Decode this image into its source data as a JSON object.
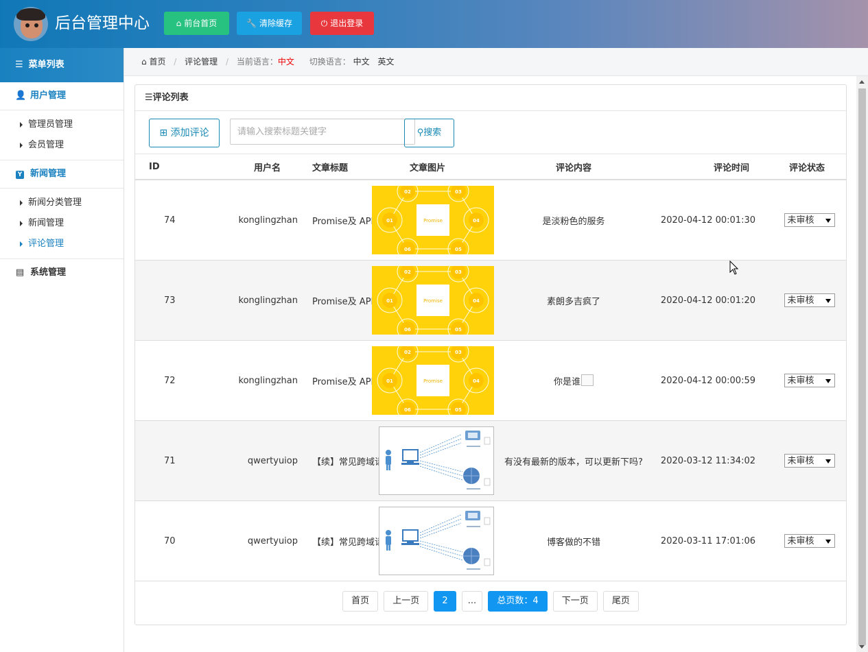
{
  "header": {
    "title": "后台管理中心",
    "buttons": {
      "home": "前台首页",
      "clear_cache": "清除缓存",
      "logout": "退出登录"
    }
  },
  "sidebar": {
    "heading": "菜单列表",
    "categories": [
      {
        "label": "用户管理",
        "items": [
          "管理员管理",
          "会员管理"
        ]
      },
      {
        "label": "新闻管理",
        "items": [
          "新闻分类管理",
          "新闻管理",
          "评论管理"
        ]
      },
      {
        "label": "系统管理",
        "items": []
      }
    ],
    "active_item": "评论管理"
  },
  "breadcrumb": {
    "home": "首页",
    "current": "评论管理",
    "lang_label": "当前语言：",
    "lang_value": "中文",
    "switch_label": "切换语言：",
    "switch_zh": "中文",
    "switch_en": "英文"
  },
  "panel": {
    "title": "评论列表",
    "add_button": "添加评论",
    "search_placeholder": "请输入搜索标题关键字",
    "search_button": "搜索"
  },
  "table": {
    "headers": [
      "ID",
      "用户名",
      "文章标题",
      "文章图片",
      "评论内容",
      "评论时间",
      "评论状态"
    ],
    "rows": [
      {
        "id": "74",
        "user": "konglingzhan",
        "title": "Promise及 API 模拟实现",
        "image": "promise",
        "content": "是淡粉色的服务",
        "time": "2020-04-12 00:01:30",
        "status": "未审核"
      },
      {
        "id": "73",
        "user": "konglingzhan",
        "title": "Promise及 API 模拟实现",
        "image": "promise",
        "content": "素朗多吉疯了",
        "time": "2020-04-12 00:01:20",
        "status": "未审核"
      },
      {
        "id": "72",
        "user": "konglingzhan",
        "title": "Promise及 API 模拟实现",
        "image": "promise",
        "content": "你是谁",
        "time": "2020-04-12 00:00:59",
        "status": "未审核"
      },
      {
        "id": "71",
        "user": "qwertyuiop",
        "title": "【续】常见跨域请求方式",
        "image": "cors",
        "content": "有没有最新的版本，可以更新下吗?",
        "time": "2020-03-12 11:34:02",
        "status": "未审核"
      },
      {
        "id": "70",
        "user": "qwertyuiop",
        "title": "【续】常见跨域请求方式",
        "image": "cors",
        "content": "博客做的不错",
        "time": "2020-03-11 17:01:06",
        "status": "未审核"
      }
    ]
  },
  "pagination": {
    "first": "首页",
    "prev": "上一页",
    "current": "2",
    "ellipsis": "...",
    "total": "总页数：4",
    "next": "下一页",
    "last": "尾页"
  },
  "images": {
    "promise": {
      "center_label": "Promise",
      "nodes": [
        "02",
        "03",
        "01",
        "04",
        "06",
        "05"
      ],
      "background": "#ffd20a"
    },
    "cors": {
      "background": "#ffffff"
    }
  },
  "colors": {
    "accent": "#1a81c0",
    "primary_btn": "#1197f2",
    "green": "#27c180",
    "blue": "#1aa1e2",
    "red": "#e8383d"
  }
}
